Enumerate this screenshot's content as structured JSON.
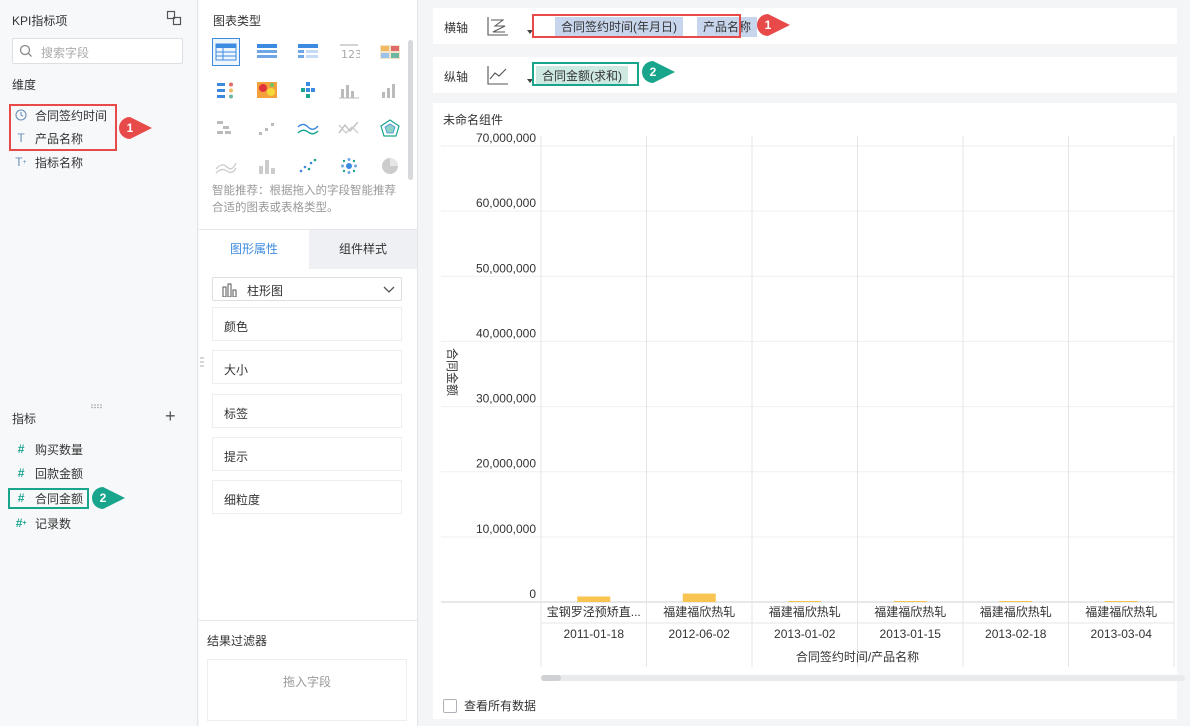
{
  "left_panel": {
    "title": "KPI指标项",
    "search_placeholder": "搜索字段",
    "dimension_label": "维度",
    "dimensions": [
      {
        "label": "合同签约时间",
        "icon": "clock-icon"
      },
      {
        "label": "产品名称",
        "icon": "text-t-icon"
      },
      {
        "label": "指标名称",
        "icon": "text-t-plus-icon"
      }
    ],
    "measure_label": "指标",
    "measures": [
      {
        "label": "购买数量",
        "icon": "hash-icon"
      },
      {
        "label": "回款金额",
        "icon": "hash-icon"
      },
      {
        "label": "合同金额",
        "icon": "hash-icon"
      },
      {
        "label": "记录数",
        "icon": "hash-plus-icon"
      }
    ],
    "badge1": "1",
    "badge2": "2",
    "colors": {
      "red": "#e84a4a",
      "green": "#19a58b"
    }
  },
  "middle_panel": {
    "chart_type_title": "图表类型",
    "hint": "智能推荐：根据拖入的字段智能推荐合适的图表或表格类型。",
    "tab_graphic": "图形属性",
    "tab_style": "组件样式",
    "chart_kind": "柱形图",
    "properties": [
      "颜色",
      "大小",
      "标签",
      "提示",
      "细粒度"
    ],
    "filter_title": "结果过滤器",
    "filter_placeholder": "拖入字段"
  },
  "right_panel": {
    "x_axis_label": "横轴",
    "x_pills": [
      "合同签约时间(年月日)",
      "产品名称"
    ],
    "y_axis_label": "纵轴",
    "y_pills": [
      "合同金额(求和)"
    ],
    "badge1": "1",
    "badge2": "2",
    "widget_title": "未命名组件",
    "view_all_label": "查看所有数据"
  },
  "chart_data": {
    "type": "bar",
    "ylabel": "合同金额",
    "xlabel": "合同签约时间/产品名称",
    "ylim": [
      0,
      70000000
    ],
    "yticks": [
      "0",
      "10,000,000",
      "20,000,000",
      "30,000,000",
      "40,000,000",
      "50,000,000",
      "60,000,000",
      "70,000,000"
    ],
    "categories": [
      {
        "product": "宝钢罗泾预矫直...",
        "date": "2011-01-18"
      },
      {
        "product": "福建福欣热轧",
        "date": "2012-06-02"
      },
      {
        "product": "福建福欣热轧",
        "date": "2013-01-02"
      },
      {
        "product": "福建福欣热轧",
        "date": "2013-01-15"
      },
      {
        "product": "福建福欣热轧",
        "date": "2013-02-18"
      },
      {
        "product": "福建福欣热轧",
        "date": "2013-03-04"
      }
    ],
    "values": [
      850000,
      1300000,
      80000,
      60000,
      70000,
      60000
    ],
    "bar_color": "#f8c552",
    "grid": true
  }
}
